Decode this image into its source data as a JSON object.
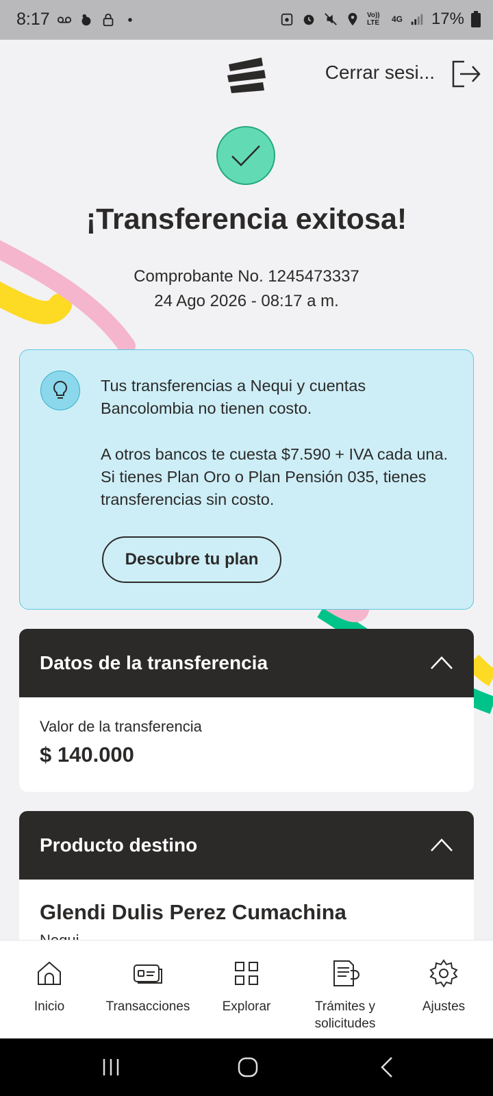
{
  "status_bar": {
    "time": "8:17",
    "left_icons": [
      "voicemail-icon",
      "notification-icon",
      "lock-icon",
      "dot-icon"
    ],
    "right_icons": [
      "vpn-icon",
      "alarm-icon",
      "mute-icon",
      "location-icon",
      "volte-icon",
      "4g-icon",
      "signal-icon"
    ],
    "volte_label": "Vo)) LTE",
    "network_label": "4G",
    "battery": "17%"
  },
  "header": {
    "logo": "bancolombia-logo-icon",
    "logout_label": "Cerrar sesi..."
  },
  "result": {
    "title": "¡Transferencia exitosa!",
    "voucher": "Comprobante No. 1245473337",
    "datetime": "24 Ago 2026 - 08:17 a m."
  },
  "info": {
    "paragraph1": "Tus transferencias a Nequi y cuentas Bancolombia no tienen costo.",
    "paragraph2": "A otros bancos te cuesta $7.590 + IVA cada una. Si tienes Plan Oro o Plan Pensión 035, tienes transferencias sin costo.",
    "button_label": "Descubre tu plan"
  },
  "transfer_data": {
    "heading": "Datos de la transferencia",
    "value_label": "Valor de la transferencia",
    "value": "$ 140.000"
  },
  "destination": {
    "heading": "Producto destino",
    "name": "Glendi Dulis Perez Cumachina",
    "bank": "Nequi"
  },
  "bottom_nav": [
    {
      "label": "Inicio",
      "icon": "home-icon"
    },
    {
      "label": "Transacciones",
      "icon": "transactions-icon"
    },
    {
      "label": "Explorar",
      "icon": "grid-icon"
    },
    {
      "label": "Trámites y solicitudes",
      "icon": "document-icon"
    },
    {
      "label": "Ajustes",
      "icon": "gear-icon"
    }
  ],
  "colors": {
    "success": "#62dbb4",
    "info_bg": "#cdeef7",
    "dark": "#2c2a29",
    "accent_yellow": "#fdda24",
    "accent_pink": "#f5b6cd",
    "accent_green": "#00c389"
  }
}
